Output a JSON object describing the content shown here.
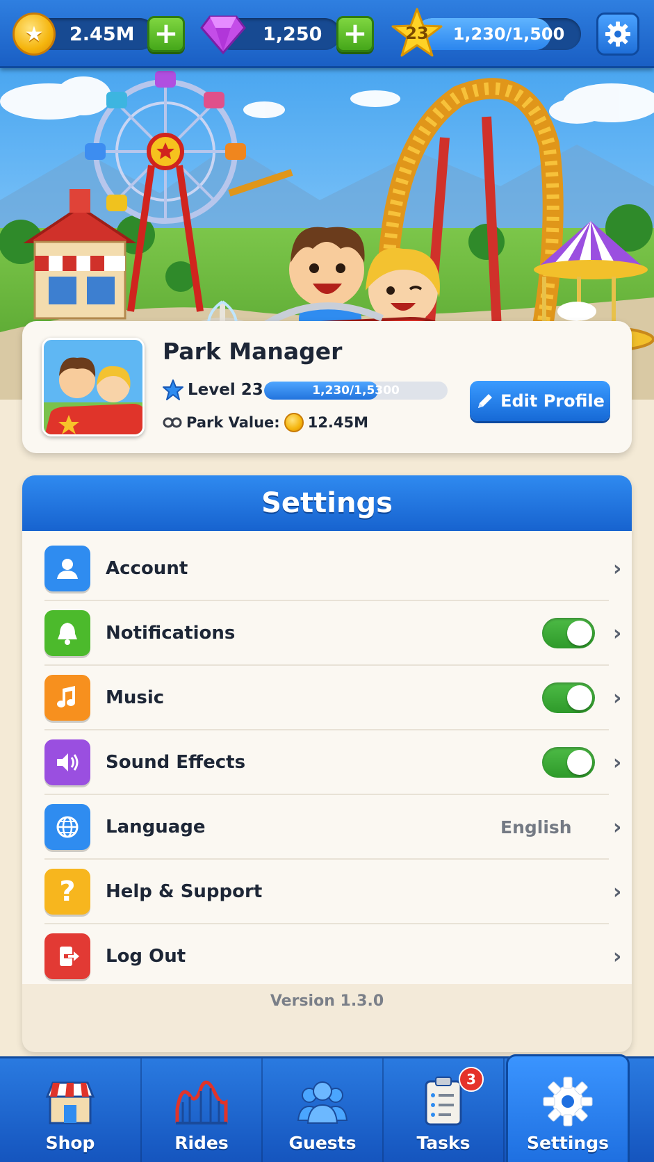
{
  "topbar": {
    "coins": "2.45M",
    "gems": "1,250",
    "level": "23",
    "xp_text": "1,230/1,500",
    "xp_fraction": 0.82
  },
  "profile": {
    "name": "Park Manager",
    "level_label": "Level 23",
    "xp_text": "1,230/1,5300",
    "xp_fraction": 0.62,
    "park_value_label": "Park Value:",
    "park_value": "12.45M",
    "edit_label": "Edit Profile"
  },
  "settings": {
    "title": "Settings",
    "items": [
      {
        "label": "Account",
        "icon": "user-icon",
        "color": "#2f8cf0"
      },
      {
        "label": "Notifications",
        "icon": "bell-icon",
        "color": "#4cba2c",
        "toggle": true
      },
      {
        "label": "Music",
        "icon": "music-note-icon",
        "color": "#f7901e",
        "toggle": true
      },
      {
        "label": "Sound Effects",
        "icon": "speaker-icon",
        "color": "#9a4fe0",
        "toggle": true
      },
      {
        "label": "Language",
        "icon": "globe-icon",
        "color": "#2f8cf0",
        "value": "English"
      },
      {
        "label": "Help & Support",
        "icon": "question-icon",
        "color": "#f7b61e"
      },
      {
        "label": "Log Out",
        "icon": "logout-icon",
        "color": "#e23a34"
      }
    ],
    "version": "Version 1.3.0"
  },
  "nav": {
    "items": [
      {
        "label": "Shop",
        "icon": "shop-icon"
      },
      {
        "label": "Rides",
        "icon": "roller-coaster-icon"
      },
      {
        "label": "Guests",
        "icon": "guests-icon"
      },
      {
        "label": "Tasks",
        "icon": "clipboard-icon",
        "badge": "3"
      },
      {
        "label": "Settings",
        "icon": "gear-icon",
        "active": true
      }
    ]
  }
}
